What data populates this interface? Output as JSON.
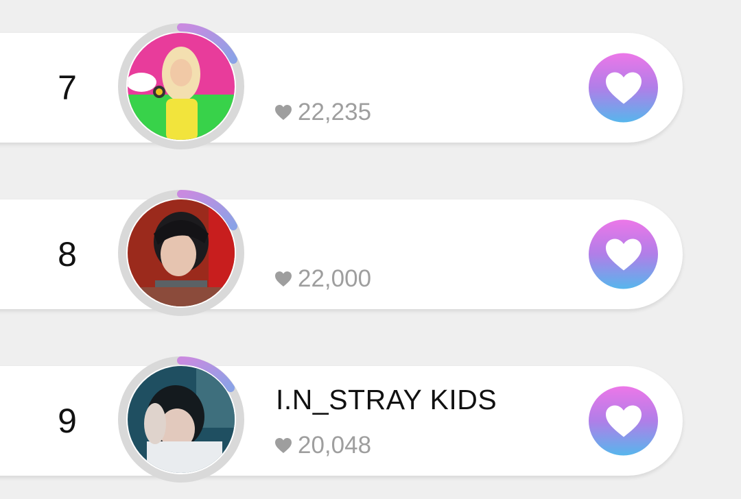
{
  "ranking": {
    "items": [
      {
        "rank": "7",
        "name": "",
        "votes": "22,235",
        "avatar_icon": "avatar-photo-blonde-idol",
        "vote_icon": "heart-icon"
      },
      {
        "rank": "8",
        "name": "",
        "votes": "22,000",
        "avatar_icon": "avatar-photo-dark-hair-idol",
        "vote_icon": "heart-icon"
      },
      {
        "rank": "9",
        "name": "I.N_STRAY KIDS",
        "votes": "20,048",
        "avatar_icon": "avatar-photo-stray-kids-in",
        "vote_icon": "heart-icon"
      }
    ]
  },
  "colors": {
    "background": "#efefef",
    "card": "#ffffff",
    "vote_gradient_top": "#ec77e8",
    "vote_gradient_bottom": "#57b6ec",
    "ring_gray": "#d9d9d9",
    "ring_accent": "#b98be6",
    "vote_count": "#9e9e9e"
  }
}
